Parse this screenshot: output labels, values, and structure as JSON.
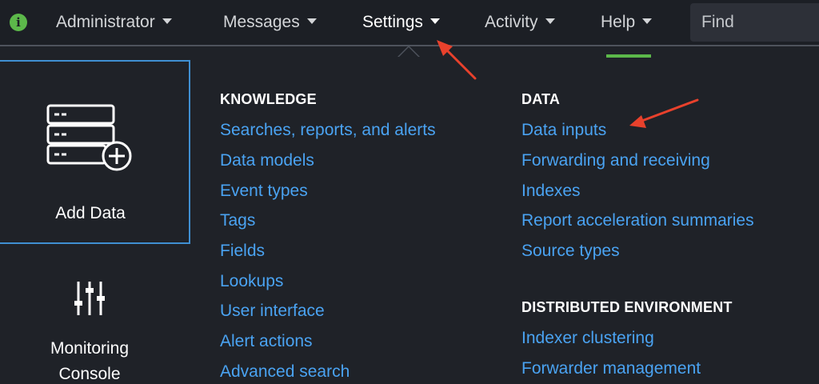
{
  "nav": {
    "items": [
      {
        "label": "Administrator",
        "active": false
      },
      {
        "label": "Messages",
        "active": false
      },
      {
        "label": "Settings",
        "active": true
      },
      {
        "label": "Activity",
        "active": false
      },
      {
        "label": "Help",
        "active": false
      }
    ],
    "find_placeholder": "Find"
  },
  "tiles": {
    "add_data": {
      "label": "Add Data",
      "icon": "add-data-icon"
    },
    "monitoring_console": {
      "label_line1": "Monitoring",
      "label_line2": "Console",
      "icon": "sliders-icon"
    }
  },
  "knowledge": {
    "title": "KNOWLEDGE",
    "links": [
      "Searches, reports, and alerts",
      "Data models",
      "Event types",
      "Tags",
      "Fields",
      "Lookups",
      "User interface",
      "Alert actions",
      "Advanced search"
    ]
  },
  "data": {
    "title": "DATA",
    "links": [
      "Data inputs",
      "Forwarding and receiving",
      "Indexes",
      "Report acceleration summaries",
      "Source types"
    ]
  },
  "distributed": {
    "title": "DISTRIBUTED ENVIRONMENT",
    "links": [
      "Indexer clustering",
      "Forwarder management"
    ]
  },
  "colors": {
    "link": "#4aa3f2",
    "accent_green": "#5cb84a",
    "tile_border": "#3f8fd2",
    "annotation_arrow": "#e8412c",
    "background": "#1f2228"
  }
}
